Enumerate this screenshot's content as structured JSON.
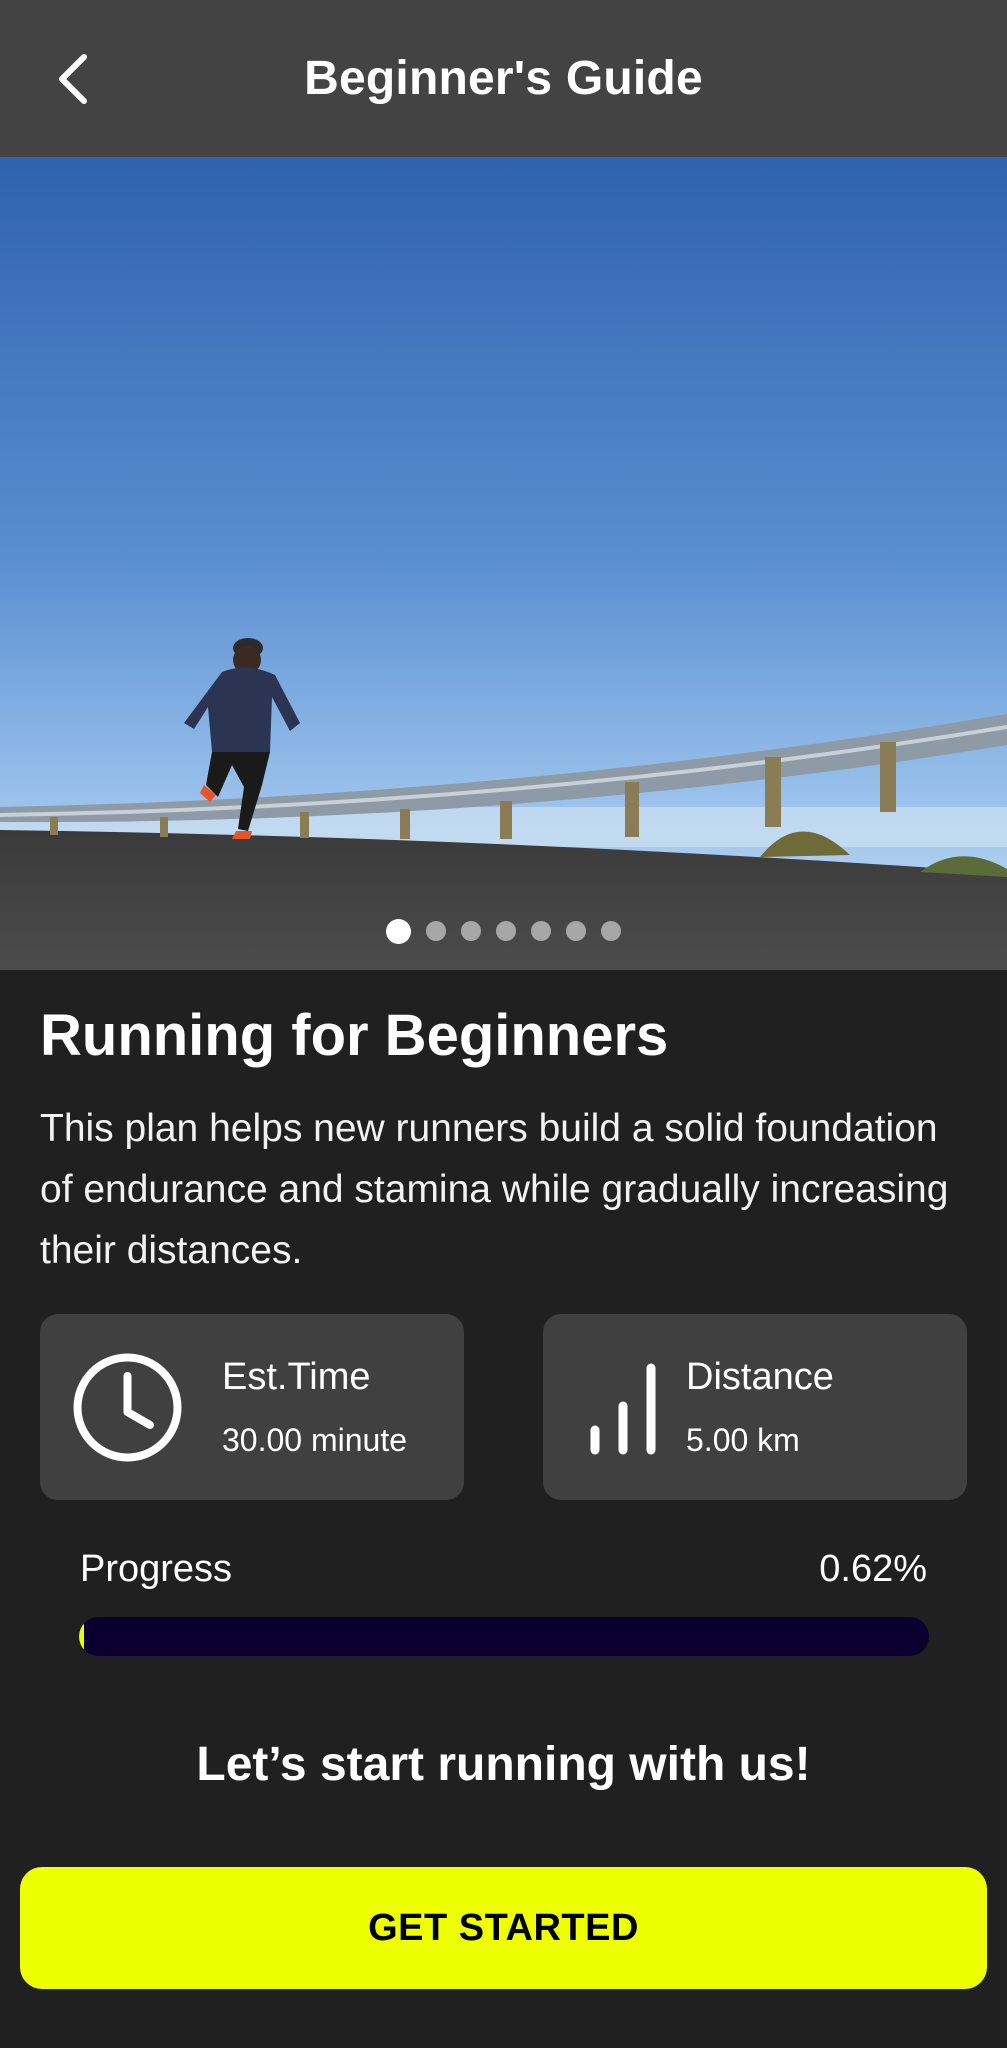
{
  "header": {
    "title": "Beginner's Guide",
    "back_icon": "chevron-left-icon"
  },
  "hero": {
    "image": "runner-on-road-photo",
    "carousel": {
      "total": 7,
      "active": 0
    }
  },
  "plan": {
    "title": "Running for Beginners",
    "description": "This plan helps new runners build a solid foundation of endurance and stamina while gradually increasing their distances."
  },
  "stats": {
    "time": {
      "label": "Est.Time",
      "value": "30.00 minute",
      "icon": "clock-icon"
    },
    "distance": {
      "label": "Distance",
      "value": "5.00 km",
      "icon": "signal-bars-icon"
    }
  },
  "progress": {
    "label": "Progress",
    "value_text": "0.62%",
    "percent": 0.62
  },
  "cta": {
    "text": "Let’s start running with us!",
    "button_label": "GET STARTED"
  },
  "colors": {
    "accent": "#eeff00",
    "background": "#202020",
    "header": "#434343",
    "card": "#404040",
    "progress_track": "#0a0030"
  }
}
